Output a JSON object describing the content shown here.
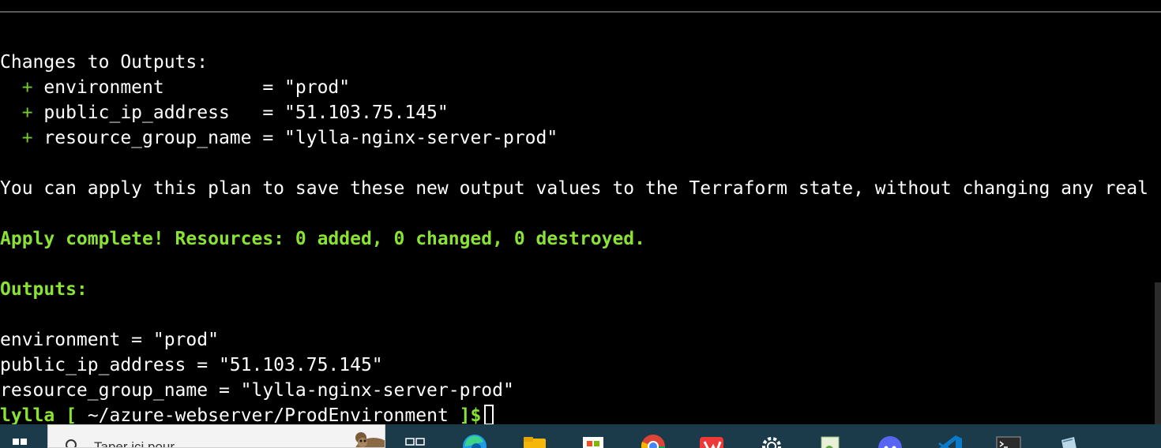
{
  "terminal": {
    "changes_header": "Changes to Outputs:",
    "plan_outputs": [
      {
        "plus": "+",
        "text": " environment         = \"prod\""
      },
      {
        "plus": "+",
        "text": " public_ip_address   = \"51.103.75.145\""
      },
      {
        "plus": "+",
        "text": " resource_group_name = \"lylla-nginx-server-prod\""
      }
    ],
    "apply_note": "You can apply this plan to save these new output values to the Terraform state, without changing any real",
    "apply_complete": "Apply complete! Resources: 0 added, 0 changed, 0 destroyed.",
    "outputs_header": "Outputs:",
    "outputs": [
      "environment = \"prod\"",
      "public_ip_address = \"51.103.75.145\"",
      "resource_group_name = \"lylla-nginx-server-prod\""
    ],
    "prompt": {
      "user": "lylla",
      "open_bracket": "[",
      "path": "~/azure-webserver/ProdEnvironment",
      "close": "]$"
    }
  },
  "taskbar": {
    "search_placeholder": "Taper ici pour",
    "icons": [
      "task-view-icon",
      "edge-icon",
      "file-explorer-icon",
      "microsoft-store-icon",
      "chrome-icon",
      "vivaldi-icon",
      "settings-icon",
      "notepad-icon",
      "discord-icon",
      "vscode-icon",
      "terminal-icon",
      "notes-icon"
    ]
  },
  "colors": {
    "background": "#000000",
    "text": "#ffffff",
    "success_green": "#8ae234",
    "plus_green": "#73c936",
    "taskbar": "#1b3a4a"
  }
}
